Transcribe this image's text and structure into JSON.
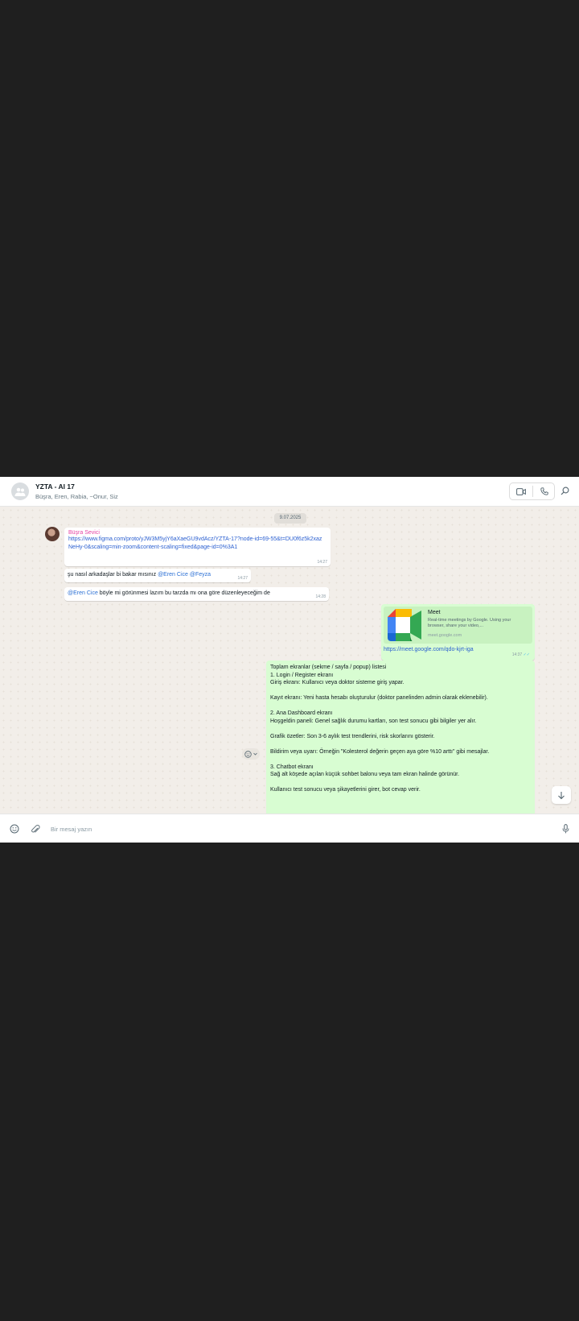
{
  "header": {
    "title": "YZTA - AI 17",
    "members": "Büşra, Eren, Rabia, ~Onur, Siz",
    "icons": [
      "group-avatar-icon",
      "video-call-icon",
      "voice-call-icon",
      "search-icon"
    ]
  },
  "chat": {
    "date_label": "9.07.2025",
    "incoming": {
      "sender_name": "Büşra Sevici",
      "messages": [
        {
          "link": "https://www.figma.com/proto/yJW3M5yjY6aXaeGU9vdAcz/YZTA-17?node-id=69-55&t=DU0f6z5k2xazNeHy-0&scaling=min-zoom&content-scaling=fixed&page-id=0%3A1",
          "time": "14:27"
        },
        {
          "text_before": "şu nasıl arkadaşlar bi bakar mısınız ",
          "mentions": "@Eren Cice @Feyza",
          "time": "14:27"
        },
        {
          "mention": "@Eren Cice",
          "text_after": " böyle mi görünmesi lazım bu tarzda mı ona göre düzenleyeceğim de",
          "time": "14:28"
        }
      ]
    },
    "outgoing_link": {
      "card_title": "Meet",
      "card_description": "Real-time meetings by Google. Using your browser, share your video,...",
      "card_domain": "meet.google.com",
      "url": "https://meet.google.com/qdo-kjrt-iga",
      "time": "14:37"
    },
    "outgoing_long": {
      "text": "Toplam ekranlar (sekme / sayfa / popup) listesi\n1. Login / Register ekranı\nGiriş ekranı: Kullanıcı veya doktor sisteme giriş yapar.\n\nKayıt ekranı: Yeni hasta hesabı oluşturulur (doktor panelinden admin olarak eklenebilir).\n\n2. Ana Dashboard ekranı\nHoşgeldin paneli: Genel sağlık durumu kartları, son test sonucu gibi bilgiler yer alır.\n\nGrafik özetler: Son 3-6 aylık test trendlerini, risk skorlarını gösterir.\n\nBildirim veya uyarı: Örneğin \"Kolesterol değerin geçen aya göre %10 arttı\" gibi mesajlar.\n\n3. Chatbot ekranı\nSağ alt köşede açılan küçük sohbet balonu veya tam ekran halinde görünür.\n\nKullanıcı test sonucu veya şikayetlerini girer, bot cevap verir."
    }
  },
  "footer": {
    "placeholder": "Bir mesaj yazın",
    "icons": [
      "emoji-icon",
      "attach-icon",
      "mic-icon"
    ]
  }
}
